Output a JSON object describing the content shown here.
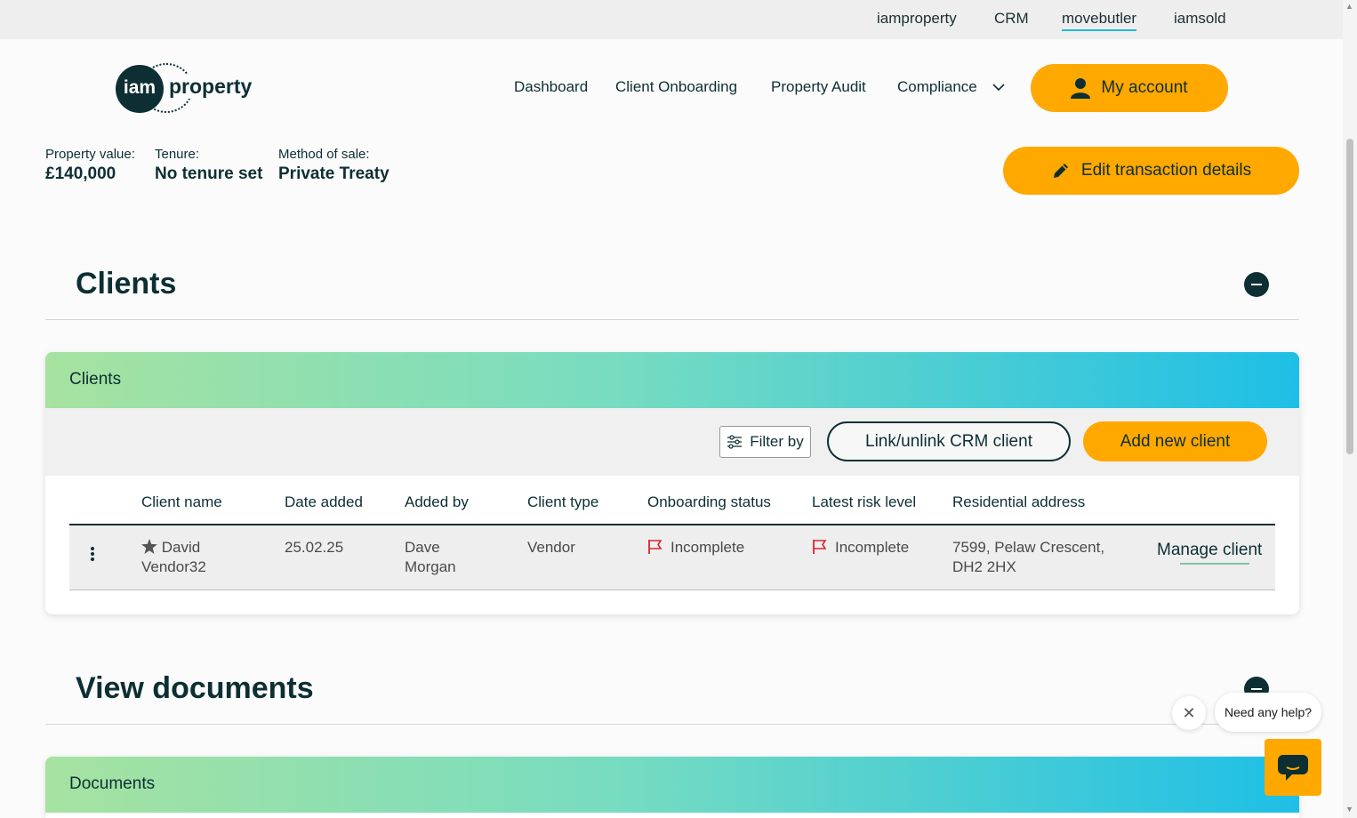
{
  "brand_links": [
    "iamproperty",
    "CRM",
    "movebutler",
    "iamsold"
  ],
  "logo": {
    "mark": "iam",
    "word": "property"
  },
  "nav": {
    "items": [
      "Dashboard",
      "Client Onboarding",
      "Property Audit",
      "Compliance"
    ],
    "account_label": "My account"
  },
  "property": {
    "value_label": "Property value:",
    "value": "£140,000",
    "tenure_label": "Tenure:",
    "tenure": "No tenure set",
    "method_label": "Method of sale:",
    "method": "Private Treaty",
    "edit_label": "Edit transaction details"
  },
  "clients_section": {
    "title": "Clients",
    "card_title": "Clients",
    "filter_label": "Filter by",
    "link_label": "Link/unlink CRM client",
    "add_label": "Add new client",
    "columns": [
      "Client name",
      "Date added",
      "Added by",
      "Client type",
      "Onboarding status",
      "Latest risk level",
      "Residential address"
    ],
    "rows": [
      {
        "name_line1": "David",
        "name_line2": "Vendor32",
        "date_added": "25.02.25",
        "added_by_line1": "Dave",
        "added_by_line2": "Morgan",
        "client_type": "Vendor",
        "onboarding_status": "Incomplete",
        "risk_level": "Incomplete",
        "address_line1": "7599, Pelaw Crescent,",
        "address_line2": "DH2 2HX",
        "action": "Manage client"
      }
    ]
  },
  "documents_section": {
    "title": "View documents",
    "card_title": "Documents"
  },
  "help": {
    "bubble": "Need any help?"
  },
  "colors": {
    "accent": "#ffa800",
    "brand_dark": "#0d2f33",
    "flag_red": "#d9262e",
    "gradient_start": "#a6e2a0",
    "gradient_end": "#1ebfe6"
  }
}
